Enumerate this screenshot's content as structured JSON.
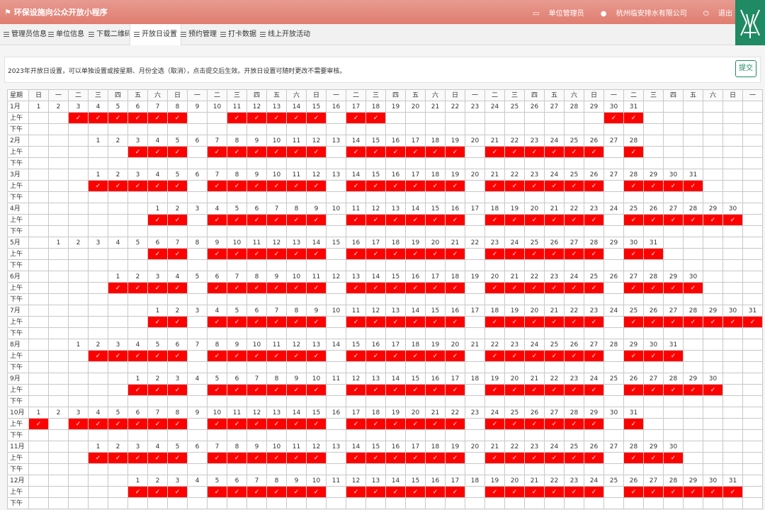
{
  "header": {
    "title": "环保设施向公众开放小程序",
    "role": "单位管理员",
    "company": "杭州临安排水有限公司",
    "logout": "退出"
  },
  "nav": {
    "tabs": [
      "管理员信息",
      "单位信息",
      "下载二维码",
      "开放日设置",
      "预约管理",
      "打卡数据",
      "线上开放活动"
    ],
    "active": 3
  },
  "notice": "2023年开放日设置，可以单独设置或按星期、月份全选（取消），点击提交后生效。开放日设置可随时更改不需要审核。",
  "submit_label": "提交",
  "calendar": {
    "corner": "星期",
    "weekday_names": [
      "日",
      "一",
      "二",
      "三",
      "四",
      "五",
      "六"
    ],
    "am_label": "上午",
    "pm_label": "下午",
    "check": "✓",
    "months": [
      {
        "label": "1月",
        "start": 0,
        "days": 31,
        "am_open": [
          3,
          4,
          5,
          6,
          7,
          8,
          11,
          12,
          13,
          14,
          15,
          17,
          18,
          30,
          31
        ]
      },
      {
        "label": "2月",
        "start": 3,
        "days": 28,
        "am_open": [
          3,
          4,
          5,
          7,
          8,
          9,
          10,
          11,
          12,
          14,
          15,
          16,
          17,
          18,
          19,
          21,
          22,
          23,
          24,
          25,
          26,
          28
        ]
      },
      {
        "label": "3月",
        "start": 3,
        "days": 31,
        "am_open": [
          1,
          2,
          3,
          4,
          5,
          7,
          8,
          9,
          10,
          11,
          12,
          14,
          15,
          16,
          17,
          18,
          19,
          21,
          22,
          23,
          24,
          25,
          26,
          28,
          29,
          30,
          31
        ]
      },
      {
        "label": "4月",
        "start": 6,
        "days": 30,
        "am_open": [
          1,
          2,
          4,
          5,
          6,
          7,
          8,
          9,
          11,
          12,
          13,
          14,
          15,
          16,
          18,
          19,
          20,
          21,
          22,
          23,
          25,
          26,
          27,
          28,
          29,
          30
        ]
      },
      {
        "label": "5月",
        "start": 1,
        "days": 31,
        "am_open": [
          6,
          7,
          9,
          10,
          11,
          12,
          13,
          14,
          16,
          17,
          18,
          19,
          20,
          21,
          23,
          24,
          25,
          26,
          27,
          28,
          30,
          31
        ]
      },
      {
        "label": "6月",
        "start": 4,
        "days": 30,
        "am_open": [
          1,
          2,
          3,
          4,
          6,
          7,
          8,
          9,
          10,
          11,
          13,
          14,
          15,
          16,
          17,
          18,
          20,
          21,
          22,
          23,
          24,
          25,
          27,
          28,
          29,
          30
        ]
      },
      {
        "label": "7月",
        "start": 6,
        "days": 31,
        "am_open": [
          1,
          2,
          4,
          5,
          6,
          7,
          8,
          9,
          11,
          12,
          13,
          14,
          15,
          16,
          18,
          19,
          20,
          21,
          22,
          23,
          25,
          26,
          27,
          28,
          29,
          30,
          31
        ]
      },
      {
        "label": "8月",
        "start": 2,
        "days": 31,
        "am_open": [
          2,
          3,
          4,
          5,
          6,
          8,
          9,
          10,
          11,
          12,
          13,
          15,
          16,
          17,
          18,
          19,
          20,
          22,
          23,
          24,
          25,
          26,
          27,
          29,
          30,
          31
        ]
      },
      {
        "label": "9月",
        "start": 5,
        "days": 30,
        "am_open": [
          1,
          2,
          3,
          5,
          6,
          7,
          8,
          9,
          10,
          12,
          13,
          14,
          15,
          16,
          17,
          19,
          20,
          21,
          22,
          23,
          24,
          26,
          27,
          28,
          29,
          30
        ]
      },
      {
        "label": "10月",
        "start": 0,
        "days": 31,
        "am_open": [
          1,
          3,
          4,
          5,
          6,
          7,
          8,
          10,
          11,
          12,
          13,
          14,
          15,
          17,
          18,
          19,
          20,
          21,
          22,
          24,
          25,
          26,
          27,
          28,
          29,
          31
        ]
      },
      {
        "label": "11月",
        "start": 3,
        "days": 30,
        "am_open": [
          1,
          2,
          3,
          4,
          5,
          7,
          8,
          9,
          10,
          11,
          12,
          14,
          15,
          16,
          17,
          18,
          19,
          21,
          22,
          23,
          24,
          25,
          26,
          28,
          29,
          30
        ]
      },
      {
        "label": "12月",
        "start": 5,
        "days": 31,
        "am_open": [
          1,
          2,
          3,
          5,
          6,
          7,
          8,
          9,
          10,
          12,
          13,
          14,
          15,
          16,
          17,
          19,
          20,
          21,
          22,
          23,
          24,
          26,
          27,
          28,
          29,
          30,
          31
        ]
      }
    ]
  }
}
